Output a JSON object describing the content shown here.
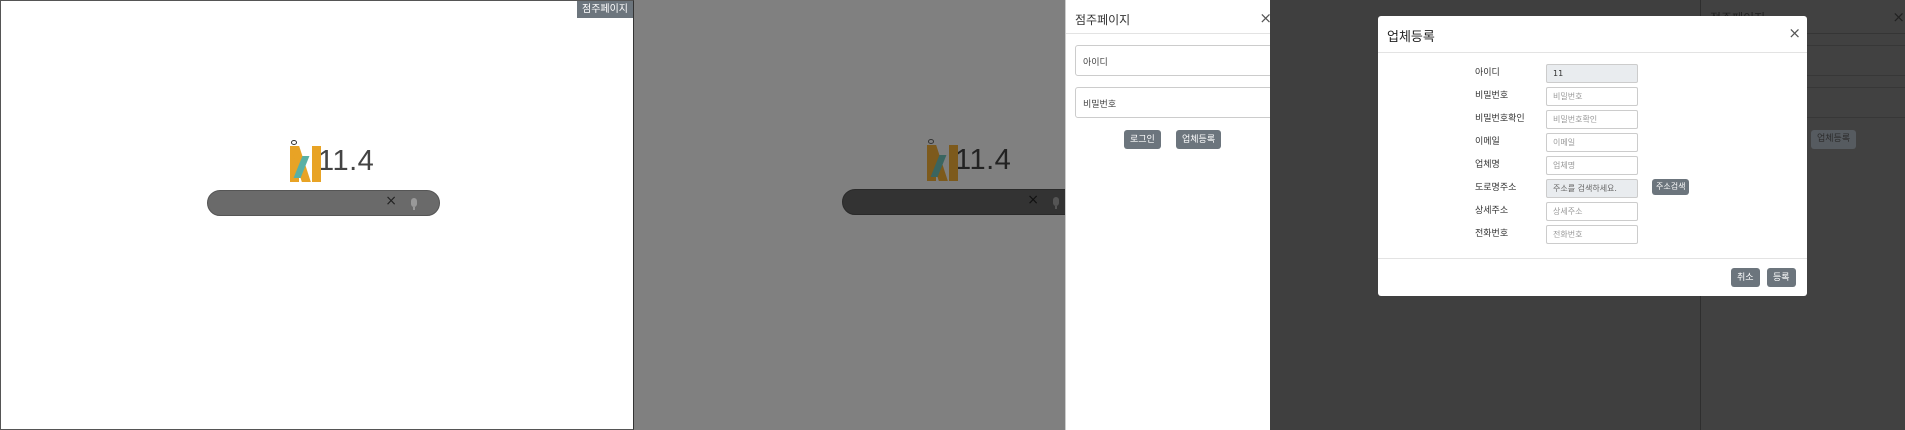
{
  "panel1": {
    "shop_button_label": "점주페이지",
    "logo_version": "11.4",
    "search_clear_icon": "×"
  },
  "panel2": {
    "logo_version": "11.4",
    "search_clear_icon": "×",
    "login_modal": {
      "title": "점주페이지",
      "close_icon": "×",
      "id_placeholder": "아이디",
      "password_placeholder": "비밀번호",
      "login_button": "로그인",
      "register_button": "업체등록"
    }
  },
  "panel3": {
    "bg_modal_title": "점주페이지",
    "bg_modal_close_icon": "×",
    "bg_register_button": "업체등록",
    "register_modal": {
      "title": "업체등록",
      "close_icon": "×",
      "fields": {
        "id": {
          "label": "아이디",
          "value": "11"
        },
        "password": {
          "label": "비밀번호",
          "placeholder": "비밀번호"
        },
        "password_confirm": {
          "label": "비밀번호확인",
          "placeholder": "비밀번호확인"
        },
        "email": {
          "label": "이메일",
          "placeholder": "이메일"
        },
        "company_name": {
          "label": "업체명",
          "placeholder": "업체명"
        },
        "road_address": {
          "label": "도로명주소",
          "placeholder": "주소를 검색하세요."
        },
        "detail_address": {
          "label": "상세주소",
          "placeholder": "상세주소"
        },
        "phone": {
          "label": "전화번호",
          "placeholder": "전화번호"
        }
      },
      "address_search_button": "주소검색",
      "cancel_button": "취소",
      "submit_button": "등록"
    }
  }
}
